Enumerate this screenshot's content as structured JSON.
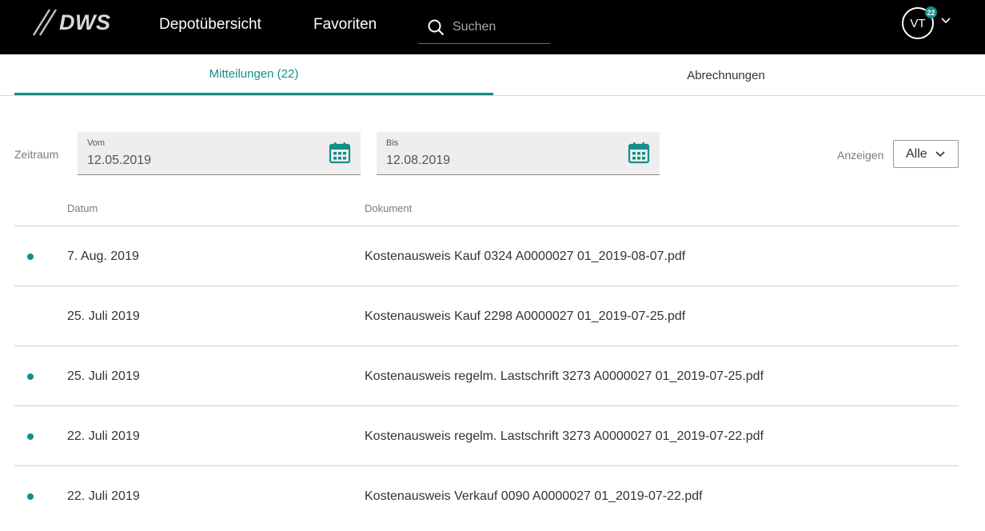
{
  "header": {
    "logo_text": "DWS",
    "nav": {
      "depot": "Depotübersicht",
      "favorites": "Favoriten"
    },
    "search": {
      "placeholder": "Suchen"
    },
    "avatar": {
      "initials": "VT",
      "badge_count": "22"
    }
  },
  "tabs": [
    {
      "label": "Mitteilungen (22)",
      "active": true
    },
    {
      "label": "Abrechnungen",
      "active": false
    }
  ],
  "filters": {
    "zeitraum_label": "Zeitraum",
    "from": {
      "label": "Vom",
      "value": "12.05.2019"
    },
    "to": {
      "label": "Bis",
      "value": "12.08.2019"
    },
    "show_label": "Anzeigen",
    "show_value": "Alle"
  },
  "table": {
    "columns": {
      "date": "Datum",
      "document": "Dokument"
    },
    "rows": [
      {
        "unread": true,
        "date": "7. Aug. 2019",
        "document": "Kostenausweis Kauf 0324 A0000027 01_2019-08-07.pdf"
      },
      {
        "unread": false,
        "date": "25. Juli 2019",
        "document": "Kostenausweis Kauf 2298 A0000027 01_2019-07-25.pdf"
      },
      {
        "unread": true,
        "date": "25. Juli 2019",
        "document": "Kostenausweis regelm. Lastschrift 3273 A0000027 01_2019-07-25.pdf"
      },
      {
        "unread": true,
        "date": "22. Juli 2019",
        "document": "Kostenausweis regelm. Lastschrift 3273 A0000027 01_2019-07-22.pdf"
      },
      {
        "unread": true,
        "date": "22. Juli 2019",
        "document": "Kostenausweis Verkauf 0090 A0000027 01_2019-07-22.pdf"
      }
    ]
  },
  "colors": {
    "accent": "#138f8a",
    "topbar": "#000000"
  }
}
